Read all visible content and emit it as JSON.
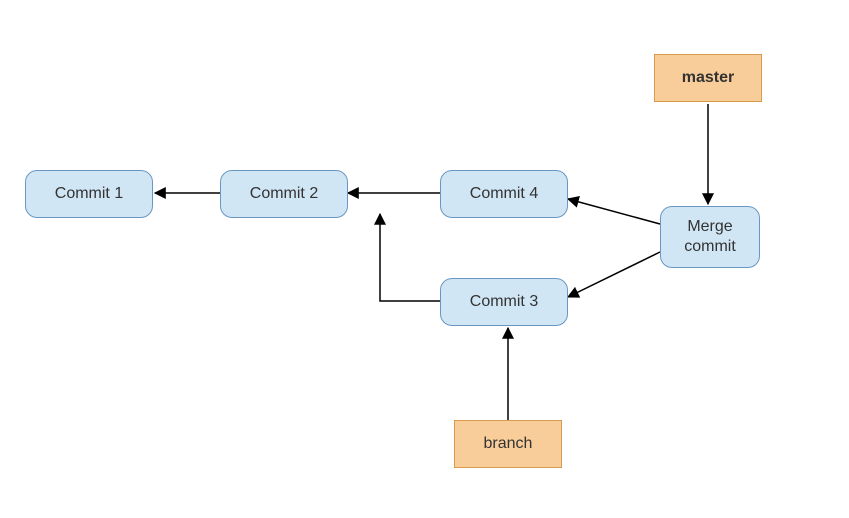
{
  "nodes": {
    "commit1": "Commit 1",
    "commit2": "Commit 2",
    "commit3": "Commit 3",
    "commit4": "Commit 4",
    "merge": "Merge\ncommit",
    "master": "master",
    "branch": "branch"
  },
  "colors": {
    "commit_fill": "#d1e6f5",
    "commit_stroke": "#6a97c2",
    "label_fill": "#f8cd9a",
    "label_stroke": "#d89a4c",
    "arrow": "#000000"
  },
  "diagram": {
    "type": "git-merge-graph",
    "edges": [
      {
        "from": "commit2",
        "to": "commit1"
      },
      {
        "from": "commit4",
        "to": "commit2"
      },
      {
        "from": "commit3",
        "to": "commit2"
      },
      {
        "from": "merge",
        "to": "commit4"
      },
      {
        "from": "merge",
        "to": "commit3"
      },
      {
        "from": "master",
        "to": "merge"
      },
      {
        "from": "branch",
        "to": "commit3"
      }
    ]
  }
}
